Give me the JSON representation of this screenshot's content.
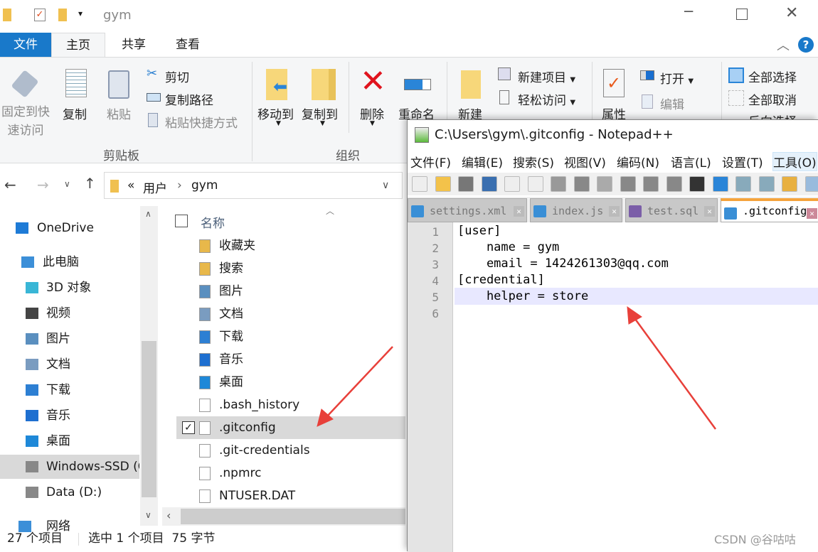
{
  "explorer": {
    "title": "gym",
    "ribbon_tabs": [
      "文件",
      "主页",
      "共享",
      "查看"
    ],
    "active_tab": "主页",
    "clipboard": {
      "pin": "固定到快速访问",
      "pin_l1": "固定到快",
      "pin_l2": "速访问",
      "copy": "复制",
      "paste": "粘贴",
      "cut": "剪切",
      "copy_path": "复制路径",
      "paste_shortcut": "粘贴快捷方式",
      "group": "剪贴板"
    },
    "organize": {
      "move_to": "移动到",
      "copy_to": "复制到",
      "delete": "删除",
      "rename": "重命名",
      "group": "组织"
    },
    "new": {
      "new_folder": "新建",
      "new_item": "新建项目",
      "easy_access": "轻松访问"
    },
    "open": {
      "properties": "属性",
      "open": "打开",
      "edit": "编辑"
    },
    "select": {
      "select_all": "全部选择",
      "select_none": "全部取消",
      "invert": "反向选择"
    },
    "address": {
      "prefix": "«",
      "parts": [
        "用户",
        "gym"
      ]
    },
    "nav": [
      {
        "label": "OneDrive",
        "icon": "cloud-icon",
        "color": "#1e7bd6"
      },
      {
        "label": "此电脑",
        "icon": "computer-icon",
        "color": "#3c8fd8"
      },
      {
        "label": "3D 对象",
        "icon": "cube-icon",
        "color": "#39b6d6"
      },
      {
        "label": "视频",
        "icon": "video-icon",
        "color": "#444"
      },
      {
        "label": "图片",
        "icon": "pictures-icon",
        "color": "#5a8fbf"
      },
      {
        "label": "文档",
        "icon": "document-icon",
        "color": "#7a9cc0"
      },
      {
        "label": "下载",
        "icon": "download-icon",
        "color": "#2d7fd3"
      },
      {
        "label": "音乐",
        "icon": "music-icon",
        "color": "#1e6fd0"
      },
      {
        "label": "桌面",
        "icon": "desktop-icon",
        "color": "#1e88d8"
      },
      {
        "label": "Windows-SSD (C:)",
        "icon": "drive-icon",
        "color": "#888"
      },
      {
        "label": "Data (D:)",
        "icon": "drive-icon",
        "color": "#888"
      },
      {
        "label": "网络",
        "icon": "network-icon",
        "color": "#3c8fd8"
      }
    ],
    "column_header": "名称",
    "files": [
      {
        "name": "收藏夹",
        "icon": "favorites-folder-icon",
        "color": "#e8b84a"
      },
      {
        "name": "搜索",
        "icon": "search-folder-icon",
        "color": "#e8b84a"
      },
      {
        "name": "图片",
        "icon": "pictures-icon",
        "color": "#5a8fbf"
      },
      {
        "name": "文档",
        "icon": "document-icon",
        "color": "#7a9cc0"
      },
      {
        "name": "下载",
        "icon": "download-icon",
        "color": "#2d7fd3"
      },
      {
        "name": "音乐",
        "icon": "music-icon",
        "color": "#1e6fd0"
      },
      {
        "name": "桌面",
        "icon": "desktop-icon",
        "color": "#1e88d8"
      },
      {
        "name": ".bash_history",
        "icon": "file-icon",
        "color": "#fff"
      },
      {
        "name": ".gitconfig",
        "icon": "file-icon",
        "color": "#fff",
        "selected": true
      },
      {
        "name": ".git-credentials",
        "icon": "file-icon",
        "color": "#fff"
      },
      {
        "name": ".npmrc",
        "icon": "file-icon",
        "color": "#fff"
      },
      {
        "name": "NTUSER.DAT",
        "icon": "file-icon",
        "color": "#fff"
      }
    ],
    "status": {
      "count": "27 个项目",
      "selection": "选中 1 个项目  75 字节"
    }
  },
  "notepad": {
    "title": "C:\\Users\\gym\\.gitconfig - Notepad++",
    "menu": [
      "文件(F)",
      "编辑(E)",
      "搜索(S)",
      "视图(V)",
      "编码(N)",
      "语言(L)",
      "设置(T)",
      "工具(O)"
    ],
    "tabs": [
      {
        "label": "settings.xml",
        "color": "#3a8fd6"
      },
      {
        "label": "index.js",
        "color": "#3a8fd6"
      },
      {
        "label": "test.sql",
        "color": "#7b5ea8"
      },
      {
        "label": ".gitconfig",
        "color": "#3a8fd6",
        "active": true
      }
    ],
    "lines": [
      "[user]",
      "    name = gym",
      "    email = 1424261303@qq.com",
      "[credential]",
      "    helper = store",
      ""
    ]
  },
  "watermark": "CSDN @谷咕咕",
  "colors": {
    "accent": "#1979ca",
    "arrow": "#e8403a",
    "tab_active": "#f5a33c"
  }
}
